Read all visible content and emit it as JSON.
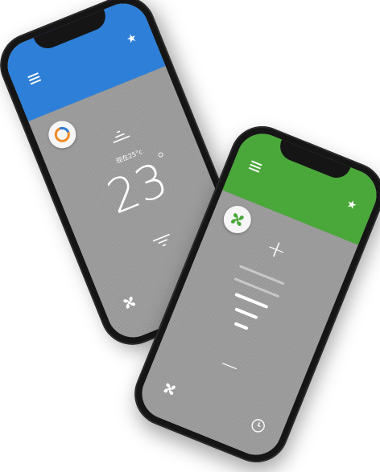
{
  "colors": {
    "ac_header": "#2e7fd8",
    "fan_header": "#4aa73a",
    "screen_bg": "#9c9c9c"
  },
  "ac_phone": {
    "menu_icon": "hamburger-icon",
    "favorite_icon": "star-icon",
    "mode_icon": "ac-mode-ring-icon",
    "current_temp_label": "现在25°c",
    "setpoint": "23",
    "degree_symbol": "°",
    "fan_icon": "fan-icon"
  },
  "fan_phone": {
    "menu_icon": "hamburger-icon",
    "favorite_icon": "star-icon",
    "mode_icon": "fan-mode-icon",
    "plus_label": "+",
    "minus_label": "−",
    "speed_level": 3,
    "speed_levels_total": 5,
    "fan_icon": "fan-icon",
    "timer_icon": "clock-icon"
  }
}
